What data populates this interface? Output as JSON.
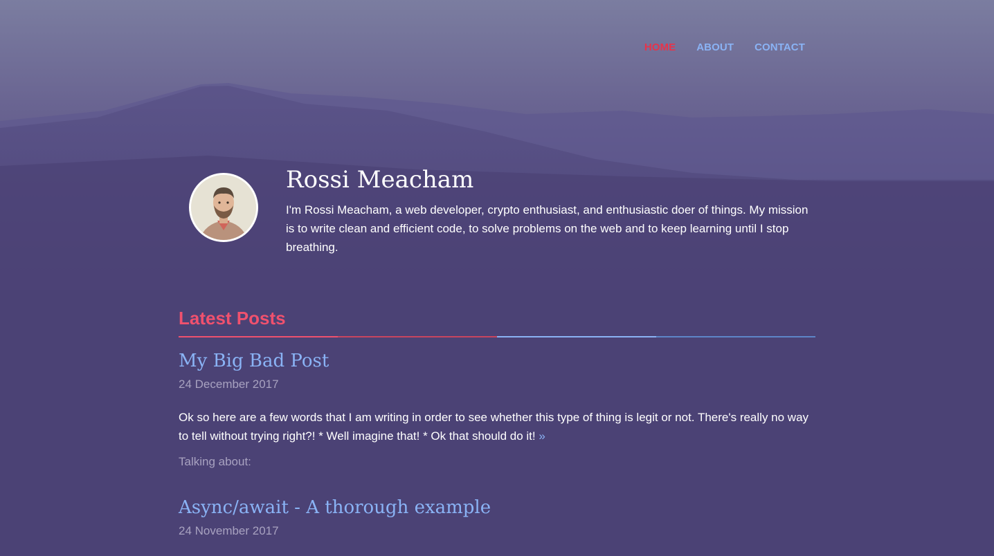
{
  "nav": {
    "items": [
      {
        "label": "HOME",
        "active": true
      },
      {
        "label": "ABOUT",
        "active": false
      },
      {
        "label": "CONTACT",
        "active": false
      }
    ]
  },
  "profile": {
    "name": "Rossi Meacham",
    "bio": "I'm Rossi Meacham, a web developer, crypto enthusiast, and enthusiastic doer of things. My mission is to write clean and efficient code, to solve problems on the web and to keep learning until I stop breathing."
  },
  "latest_posts": {
    "heading": "Latest Posts",
    "posts": [
      {
        "title": "My Big Bad Post",
        "date": "24 December 2017",
        "excerpt": "Ok so here are a few words that I am writing in order to see whether this type of thing is legit or not. There's really no way to tell without trying right?! * Well imagine that! * Ok that should do it!",
        "read_more": "»",
        "tags_label": "Talking about:"
      },
      {
        "title": "Async/await - A thorough example",
        "date": "24 November 2017"
      }
    ]
  },
  "colors": {
    "background": "#4b4275",
    "accent_red": "#f0516e",
    "accent_blue": "#8ab3f5",
    "nav_active": "#e8334a",
    "muted_text": "#a8a2c0"
  }
}
